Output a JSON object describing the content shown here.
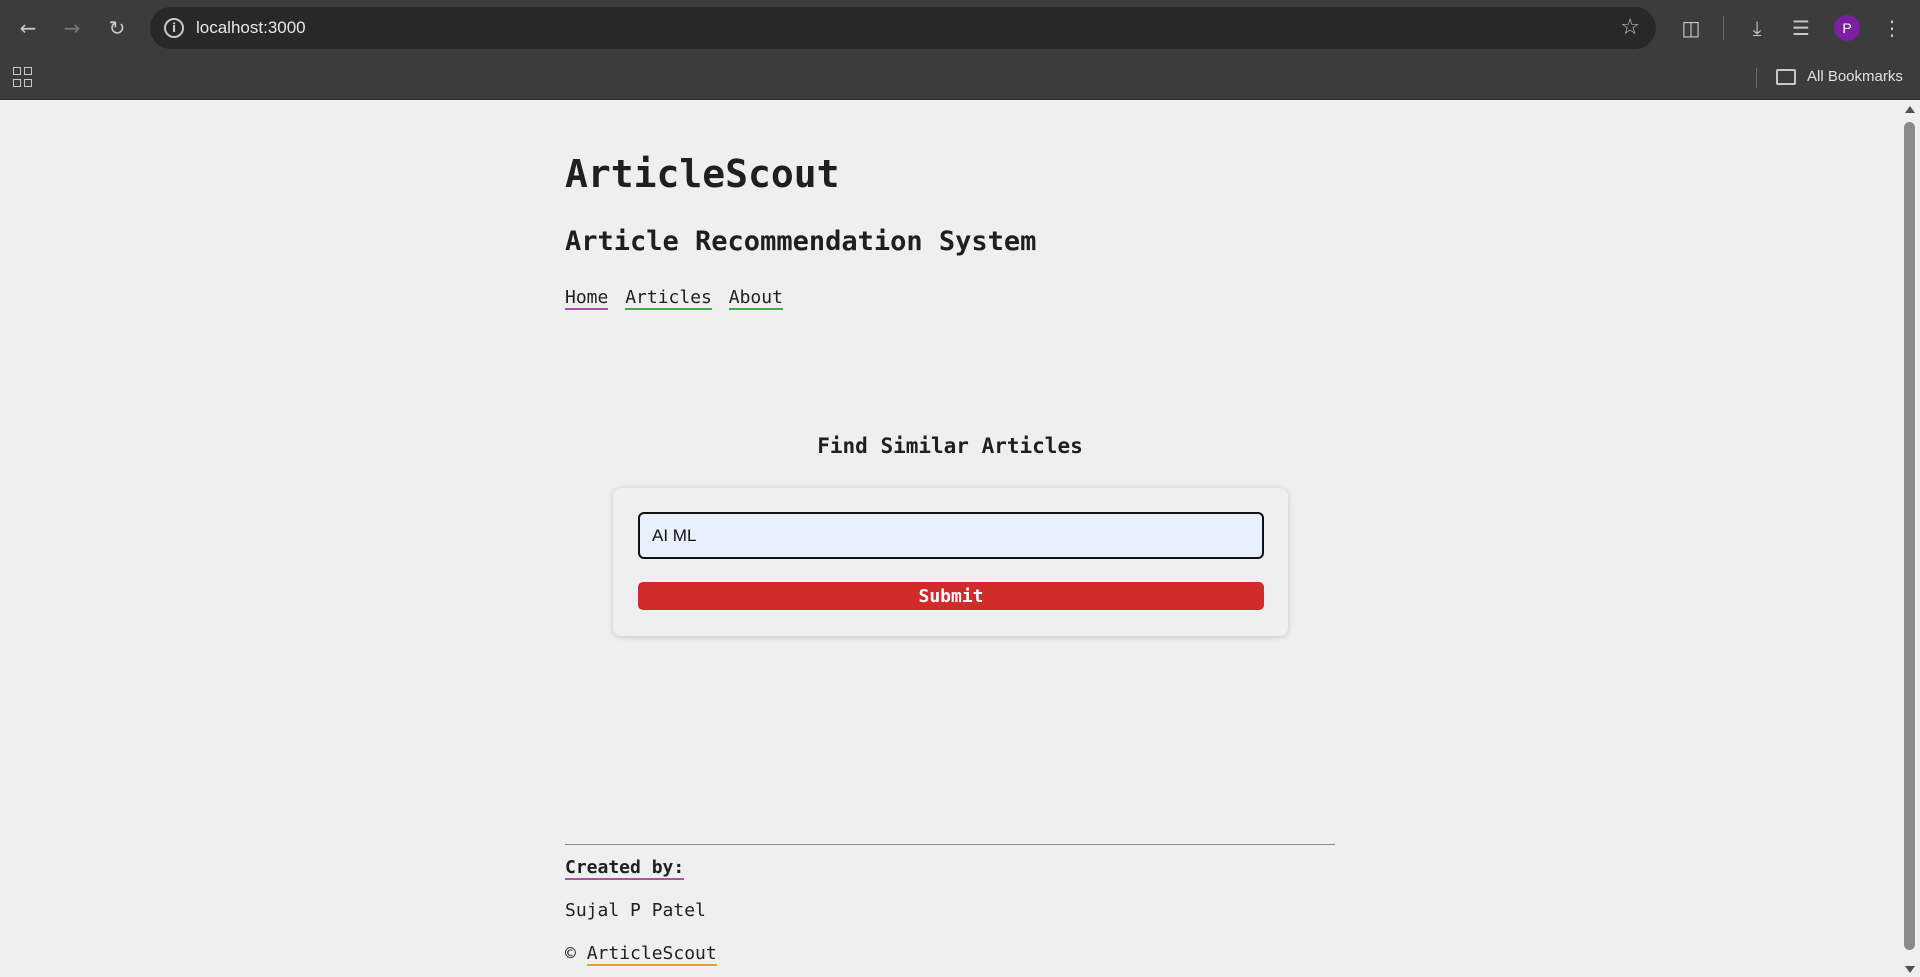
{
  "browser": {
    "url": "localhost:3000",
    "bookmarks_label": "All Bookmarks",
    "profile_initial": "P",
    "profile_color": "#7b1fa2"
  },
  "site": {
    "title": "ArticleScout",
    "subtitle": "Article Recommendation System",
    "nav": {
      "home": "Home",
      "articles": "Articles",
      "about": "About"
    }
  },
  "search": {
    "heading": "Find Similar Articles",
    "input_value": "AI ML",
    "submit_label": "Submit",
    "submit_color": "#d12a2a"
  },
  "footer": {
    "created_by_label": "Created by:",
    "author": "Sujal P Patel",
    "copyright_symbol": "©",
    "copyright_link": "ArticleScout"
  }
}
